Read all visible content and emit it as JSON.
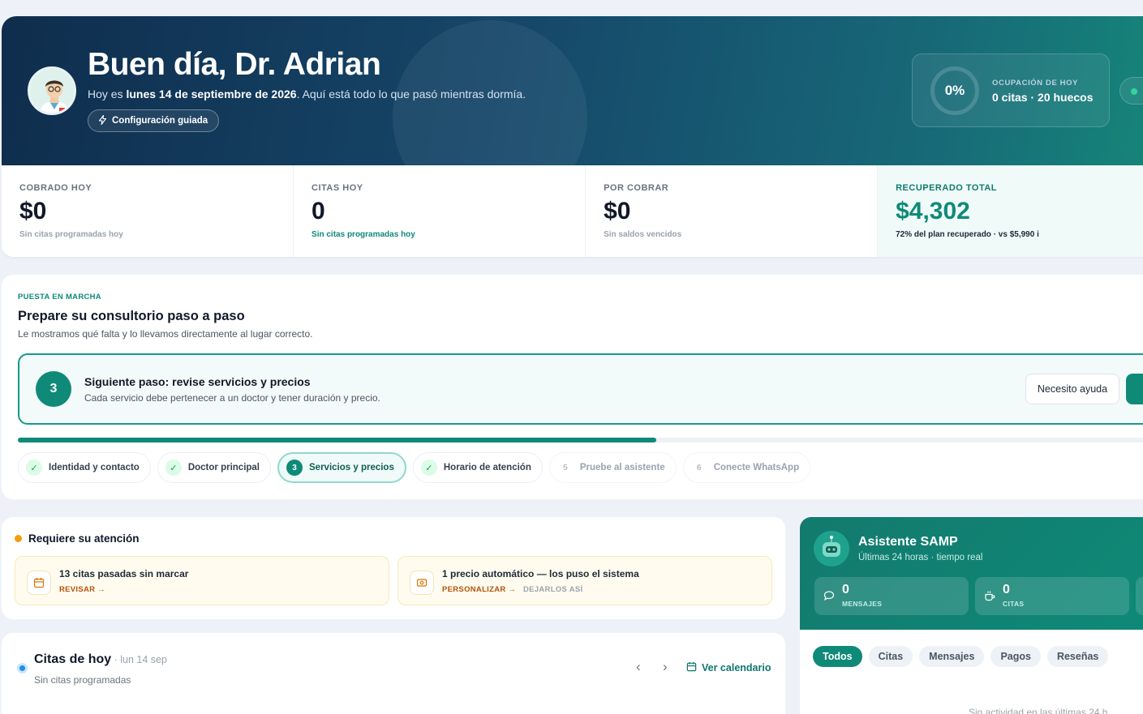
{
  "hero": {
    "greeting": "Buen día, Dr. Adrian",
    "sub_prefix": "Hoy es",
    "sub_date": "lunes 14 de septiembre de 2026",
    "sub_suffix": ". Aquí está todo lo que pasó mientras dormía.",
    "guided_button": "Configuración guiada",
    "occupancy": {
      "percent": "0%",
      "label": "OCUPACIÓN DE HOY",
      "value": "0 citas · 20 huecos"
    }
  },
  "stats": [
    {
      "label": "COBRADO HOY",
      "value": "$0",
      "note": "Sin citas programadas hoy"
    },
    {
      "label": "CITAS HOY",
      "value": "0",
      "note": "Sin citas programadas hoy"
    },
    {
      "label": "POR COBRAR",
      "value": "$0",
      "note": "Sin saldos vencidos"
    },
    {
      "label": "RECUPERADO TOTAL",
      "value": "$4,302",
      "note": "72% del plan recuperado · vs $5,990 i"
    }
  ],
  "setup": {
    "eyebrow": "PUESTA EN MARCHA",
    "title": "Prepare su consultorio paso a paso",
    "description": "Le mostramos qué falta y lo llevamos directamente al lugar correcto.",
    "next_number": "3",
    "next_title": "Siguiente paso: revise servicios y precios",
    "next_description": "Cada servicio debe pertenecer a un doctor y tener duración y precio.",
    "help_button": "Necesito ayuda",
    "progress": 0.55,
    "steps": [
      {
        "label": "Identidad y contacto",
        "mark": "✓"
      },
      {
        "label": "Doctor principal",
        "mark": "✓"
      },
      {
        "label": "Servicios y precios",
        "mark": "3"
      },
      {
        "label": "Horario de atención",
        "mark": "✓"
      },
      {
        "label": "Pruebe al asistente",
        "mark": "5"
      },
      {
        "label": "Conecte WhatsApp",
        "mark": "6"
      }
    ]
  },
  "attention": {
    "title": "Requiere su atención",
    "items": [
      {
        "title": "13 citas pasadas sin marcar",
        "action": "REVISAR →"
      },
      {
        "title": "1 precio automático — los puso el sistema",
        "action": "PERSONALIZAR →",
        "secondary": "DEJARLOS ASÍ"
      }
    ]
  },
  "appointments": {
    "title": "Citas de hoy",
    "date": " · lun 14 sep",
    "subtitle": "Sin citas programadas",
    "prev": "‹",
    "next": "›",
    "calendar_link": "Ver calendario"
  },
  "assistant": {
    "title": "Asistente SAMP",
    "subtitle": "Últimas 24 horas · tiempo real",
    "metrics": [
      {
        "value": "0",
        "label": "MENSAJES"
      },
      {
        "value": "0",
        "label": "CITAS"
      }
    ],
    "filters": [
      "Todos",
      "Citas",
      "Mensajes",
      "Pagos",
      "Reseñas"
    ],
    "empty": "Sin actividad en las últimas 24 h"
  },
  "colors": {
    "brand": "#0f8a78",
    "hero_dark": "#0f2d4d",
    "warning": "#f59e0b",
    "info": "#1e90e8"
  },
  "icons": [
    "doctor-avatar",
    "bolt-icon",
    "check-icon",
    "calendar-icon",
    "price-tag-icon",
    "chevron-left-icon",
    "chevron-right-icon",
    "robot-avatar",
    "chat-icon",
    "cup-icon"
  ]
}
